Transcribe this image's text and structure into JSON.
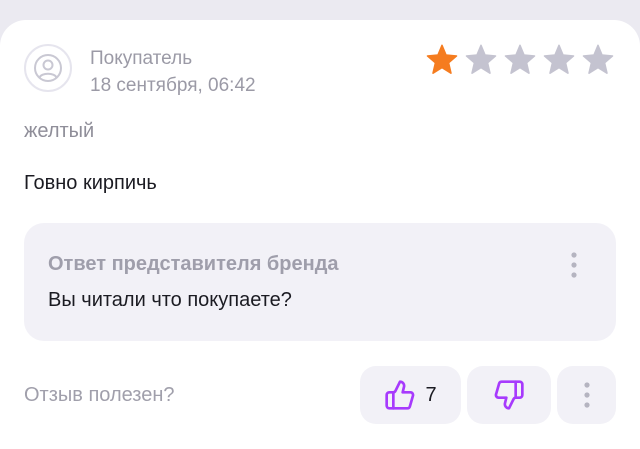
{
  "review": {
    "author": "Покупатель",
    "date": "18 сентября, 06:42",
    "rating": 1,
    "max_rating": 5,
    "variant": "желтый",
    "text": "Говно кирпичь"
  },
  "brand_reply": {
    "title": "Ответ представителя бренда",
    "text": "Вы читали что покупаете?"
  },
  "feedback": {
    "question": "Отзыв полезен?",
    "like_count": "7"
  },
  "icons": {
    "avatar": "user-icon",
    "star": "star-icon",
    "like": "thumbs-up-icon",
    "dislike": "thumbs-down-icon",
    "more": "more-vertical-icon"
  },
  "colors": {
    "star_filled": "#f57c1f",
    "star_empty": "#c4c3d0",
    "thumb_icon": "#a73afd",
    "card_background": "#ffffff",
    "reply_background": "#f2f1f7",
    "page_background": "#ebeaf1"
  }
}
